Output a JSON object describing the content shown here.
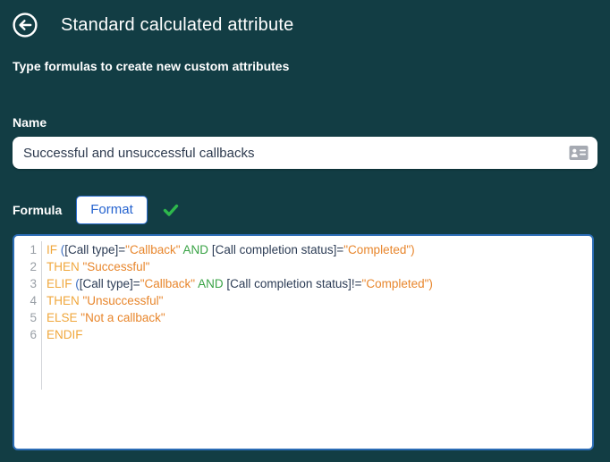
{
  "theme": {
    "background": "#123d44",
    "accent_blue": "#2563cf",
    "editor_border": "#2b6cb5",
    "keyword_color": "#f0a73c",
    "string_color": "#e8862c",
    "and_color": "#3aa346",
    "default_code_color": "#2c3c55",
    "open_paren_color": "#3e6fc0",
    "check_color": "#2eb84c",
    "line_number_color": "#999fa6"
  },
  "header": {
    "title": "Standard calculated attribute",
    "back_icon": "arrow-left-circle"
  },
  "subtitle": "Type formulas to create new custom attributes",
  "name_field": {
    "label": "Name",
    "value": "Successful and unsuccessful callbacks",
    "suffix_icon": "id-card-icon"
  },
  "formula": {
    "label": "Formula",
    "format_button_label": "Format",
    "status_icon": "check-icon"
  },
  "editor": {
    "lines": [
      {
        "num": "1",
        "tokens": [
          [
            "kw",
            "IF "
          ],
          [
            "po",
            "("
          ],
          [
            "def",
            "[Call type]="
          ],
          [
            "str",
            "\"Callback\""
          ],
          [
            "def",
            " "
          ],
          [
            "and",
            "AND"
          ],
          [
            "def",
            " [Call completion status]="
          ],
          [
            "str",
            "\"Completed\""
          ],
          [
            "pc",
            ")"
          ]
        ]
      },
      {
        "num": "2",
        "tokens": [
          [
            "kw",
            "THEN "
          ],
          [
            "str",
            "\"Successful\""
          ]
        ]
      },
      {
        "num": "3",
        "tokens": [
          [
            "kw",
            "ELIF "
          ],
          [
            "po",
            "("
          ],
          [
            "def",
            "[Call type]="
          ],
          [
            "str",
            "\"Callback\""
          ],
          [
            "def",
            " "
          ],
          [
            "and",
            "AND"
          ],
          [
            "def",
            " [Call completion status]!="
          ],
          [
            "str",
            "\"Completed\""
          ],
          [
            "pc",
            ")"
          ]
        ]
      },
      {
        "num": "4",
        "tokens": [
          [
            "kw",
            "THEN "
          ],
          [
            "str",
            "\"Unsuccessful\""
          ]
        ]
      },
      {
        "num": "5",
        "tokens": [
          [
            "kw",
            "ELSE "
          ],
          [
            "str",
            "\"Not a callback\""
          ]
        ]
      },
      {
        "num": "6",
        "tokens": [
          [
            "kw",
            "ENDIF"
          ]
        ]
      }
    ],
    "plain_text": "IF ([Call type]=\"Callback\" AND [Call completion status]=\"Completed\")\nTHEN \"Successful\"\nELIF ([Call type]=\"Callback\" AND [Call completion status]!=\"Completed\")\nTHEN \"Unsuccessful\"\nELSE \"Not a callback\"\nENDIF"
  }
}
